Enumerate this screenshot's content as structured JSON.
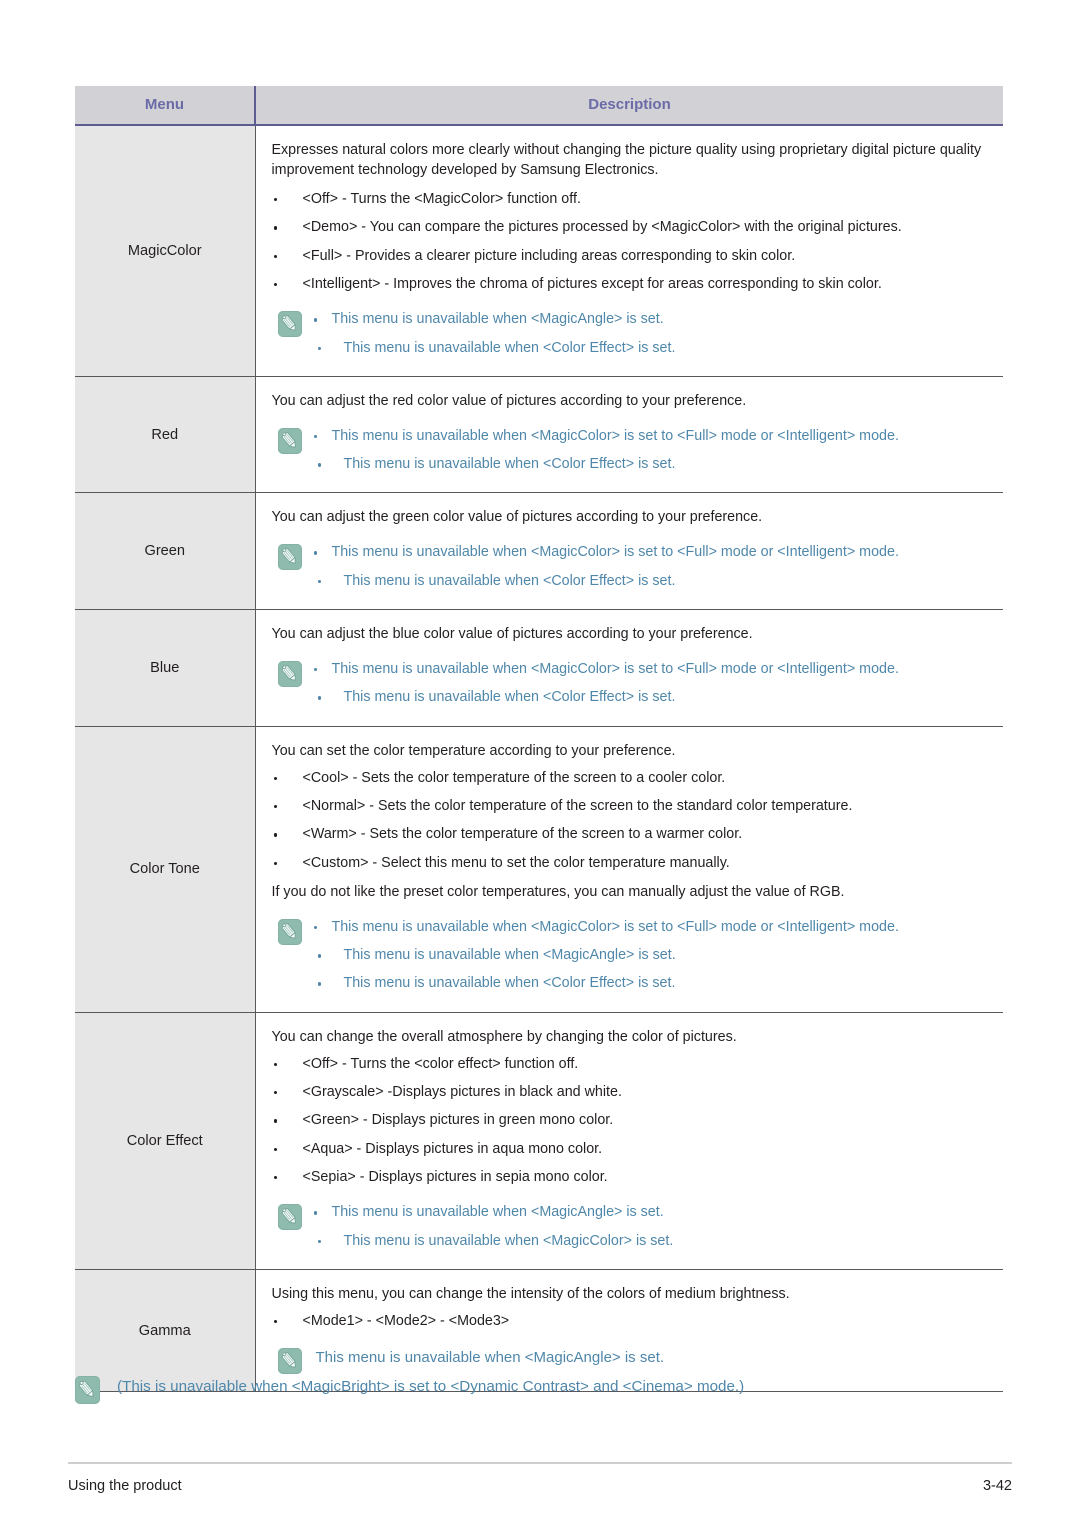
{
  "table": {
    "headers": {
      "menu": "Menu",
      "description": "Description"
    },
    "rows": [
      {
        "menu": "MagicColor",
        "intro": "Expresses natural colors more clearly without changing the picture quality using proprietary digital picture quality improvement technology developed by Samsung Electronics.",
        "bullets": [
          "<Off> - Turns the <MagicColor> function off.",
          "<Demo> - You can compare the pictures processed by <MagicColor> with the original pictures.",
          "<Full> - Provides a clearer picture including areas corresponding to skin color.",
          "<Intelligent> - Improves the chroma of pictures except for areas corresponding to skin color."
        ],
        "notes": [
          "This menu is unavailable when <MagicAngle> is set.",
          "This menu is unavailable when <Color Effect> is set."
        ]
      },
      {
        "menu": "Red",
        "intro": "You can adjust the red color value of pictures according to your preference.",
        "bullets": [],
        "notes": [
          "This menu is unavailable when <MagicColor> is set to <Full> mode or <Intelligent> mode.",
          "This menu is unavailable when <Color Effect> is set."
        ]
      },
      {
        "menu": "Green",
        "intro": "You can adjust the green color value of pictures according to your preference.",
        "bullets": [],
        "notes": [
          "This menu is unavailable when <MagicColor> is set to <Full> mode or <Intelligent> mode.",
          "This menu is unavailable when <Color Effect> is set."
        ]
      },
      {
        "menu": "Blue",
        "intro": "You can adjust the blue color value of pictures according to your preference.",
        "bullets": [],
        "notes": [
          "This menu is unavailable when <MagicColor> is set to <Full> mode or <Intelligent> mode.",
          "This menu is unavailable when <Color Effect> is set."
        ]
      },
      {
        "menu": "Color Tone",
        "intro": "You can set the color temperature according to your preference.",
        "bullets": [
          "<Cool> - Sets the color temperature of the screen to a cooler color.",
          "<Normal> - Sets the color temperature of the screen to the standard color temperature.",
          "<Warm> - Sets the color temperature of the screen to a warmer color.",
          "<Custom> - Select this menu to set the color temperature manually."
        ],
        "outro": "If you do not like the preset color temperatures, you can manually adjust the value of RGB.",
        "notes": [
          "This menu is unavailable when <MagicColor> is set to <Full> mode or <Intelligent> mode.",
          "This menu is unavailable when <MagicAngle> is set.",
          "This menu is unavailable when <Color Effect> is set."
        ]
      },
      {
        "menu": "Color Effect",
        "intro": "You can change the overall atmosphere by changing the color of pictures.",
        "bullets": [
          "<Off> - Turns the <color effect> function off.",
          "<Grayscale> -Displays pictures in black and white.",
          "<Green> - Displays pictures in green mono color.",
          "<Aqua> - Displays pictures in aqua mono color.",
          "<Sepia> - Displays pictures in sepia mono color."
        ],
        "notes": [
          "This menu is unavailable when <MagicAngle> is set.",
          "This menu is unavailable when <MagicColor> is set."
        ]
      },
      {
        "menu": "Gamma",
        "intro": "Using this menu, you can change the intensity of the colors of medium brightness.",
        "bullets": [
          "<Mode1> - <Mode2> - <Mode3>"
        ],
        "plain_note": "This menu is unavailable when <MagicAngle> is set."
      }
    ]
  },
  "footer_note": {
    "text": "(This is unavailable when <MagicBright> is set to <Dynamic Contrast> and <Cinema> mode.)"
  },
  "page_footer": {
    "section": "Using the product",
    "page_number": "3-42"
  },
  "colors": {
    "header_background": "#d2d2d6",
    "header_text": "#6b6ba8",
    "menu_cell_background": "#e6e6e6",
    "note_text": "#4f87aa",
    "note_icon_background": "#8fbaae",
    "body_text": "#231f20",
    "rule": "#cfcfcf"
  },
  "icons": {
    "note": "pencil-note-icon"
  }
}
